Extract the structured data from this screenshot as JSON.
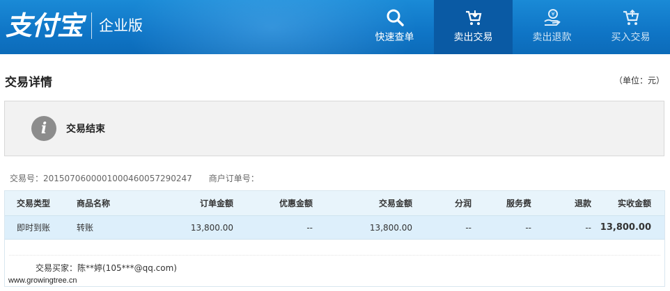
{
  "header": {
    "brand": "支付宝",
    "edition": "企业版",
    "nav": [
      {
        "label": "快速查单",
        "icon": "search-icon",
        "active": false
      },
      {
        "label": "卖出交易",
        "icon": "cart-icon",
        "active": true
      },
      {
        "label": "卖出退款",
        "icon": "refund-icon",
        "active": false
      },
      {
        "label": "买入交易",
        "icon": "cart-icon",
        "active": false
      }
    ],
    "colors": {
      "bar": "#0f75c6",
      "active": "#0a5aa4"
    }
  },
  "page": {
    "title": "交易详情",
    "unit": "（单位：元）"
  },
  "status": {
    "icon": "info-icon",
    "text": "交易结束"
  },
  "meta": {
    "trade_no": "交易号：2015070600001000460057290247",
    "merchant_order": "商户订单号："
  },
  "table": {
    "headers": [
      "交易类型",
      "商品名称",
      "订单金额",
      "优惠金额",
      "交易金额",
      "分润",
      "服务费",
      "退款",
      "实收金额"
    ],
    "row": [
      "即时到账",
      "转账",
      "13,800.00",
      "--",
      "13,800.00",
      "--",
      "--",
      "--",
      "13,800.00"
    ],
    "highlight_color": "#e0620d"
  },
  "buyer": "交易买家：陈**婷(105***@qq.com)",
  "watermark": "www.growingtree.cn"
}
